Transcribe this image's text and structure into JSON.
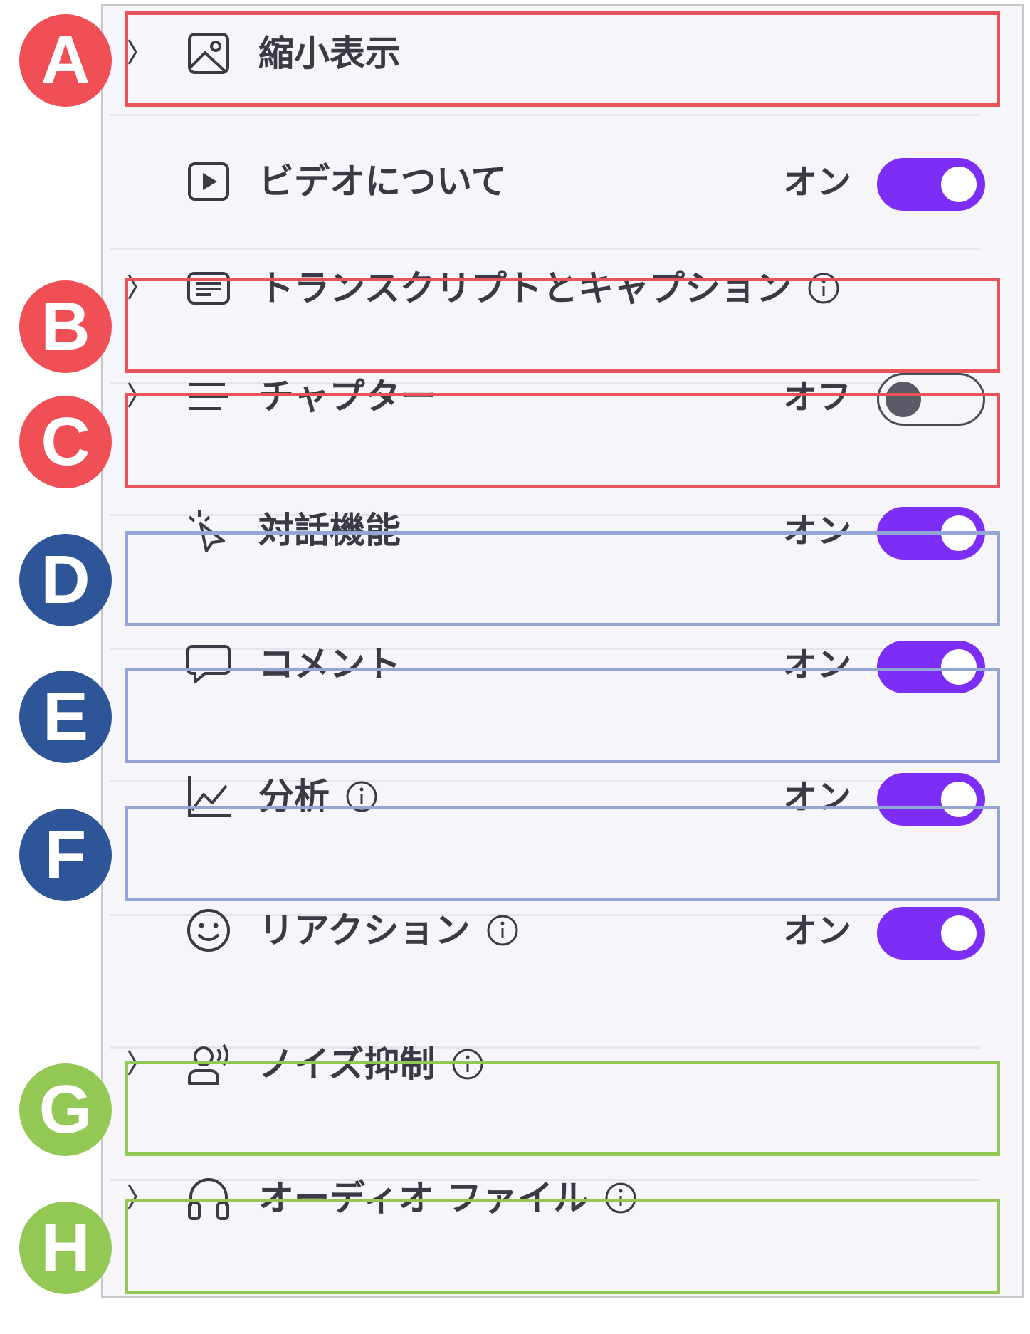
{
  "colors": {
    "accent": "#7c2ef7",
    "red_box": "#e8535a",
    "blue_box": "#93a6d6",
    "green_box": "#92c853",
    "badge_red": "#ef4f55",
    "badge_navy": "#2e5597",
    "badge_green": "#92c853"
  },
  "rows": [
    {
      "label": "縮小表示",
      "icon": "image-icon",
      "expandable": true,
      "info": false,
      "state": "",
      "toggle": null
    },
    {
      "label": "ビデオについて",
      "icon": "play-video-icon",
      "expandable": false,
      "info": false,
      "state": "オン",
      "toggle": "on"
    },
    {
      "label": "トランスクリプトとキャプション",
      "icon": "transcript-icon",
      "expandable": true,
      "info": true,
      "state": "",
      "toggle": null
    },
    {
      "label": "チャプター",
      "icon": "chapters-list-icon",
      "expandable": true,
      "info": false,
      "state": "オフ",
      "toggle": "off"
    },
    {
      "label": "対話機能",
      "icon": "interactive-cursor-icon",
      "expandable": false,
      "info": false,
      "state": "オン",
      "toggle": "on"
    },
    {
      "label": "コメント",
      "icon": "comment-icon",
      "expandable": false,
      "info": false,
      "state": "オン",
      "toggle": "on"
    },
    {
      "label": "分析",
      "icon": "analytics-chart-icon",
      "expandable": false,
      "info": true,
      "state": "オン",
      "toggle": "on"
    },
    {
      "label": "リアクション",
      "icon": "smiley-icon",
      "expandable": false,
      "info": true,
      "state": "オン",
      "toggle": "on"
    },
    {
      "label": "ノイズ抑制",
      "icon": "noise-suppression-icon",
      "expandable": true,
      "info": true,
      "state": "",
      "toggle": null
    },
    {
      "label": "オーディオ ファイル",
      "icon": "headphones-icon",
      "expandable": true,
      "info": true,
      "state": "",
      "toggle": null
    }
  ],
  "badges": [
    "A",
    "B",
    "C",
    "D",
    "E",
    "F",
    "G",
    "H"
  ]
}
